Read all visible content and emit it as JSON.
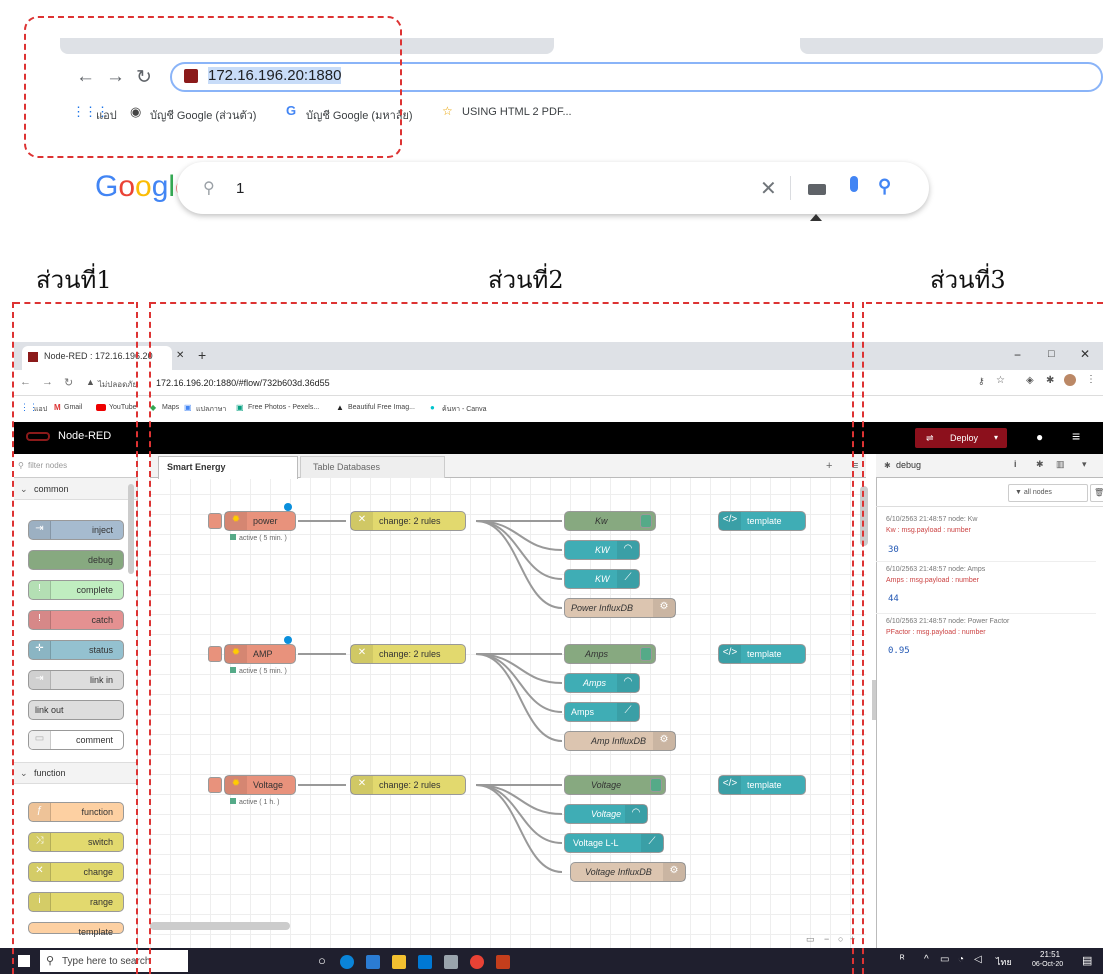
{
  "top_browser": {
    "url": "172.16.196.20:1880",
    "bookmarks": [
      "แอป",
      "บัญชี Google (ส่วนตัว)",
      "บัญชี Google (มหาลัย)",
      "USING HTML 2 PDF..."
    ],
    "google_logo": "Google",
    "search_value": "1"
  },
  "section_labels": [
    "ส่วนที่1",
    "ส่วนที่2",
    "ส่วนที่3"
  ],
  "nodered_browser": {
    "tab_title": "Node-RED : 172.16.196.20",
    "address_prefix": "ไม่ปลอดภัย",
    "address": "172.16.196.20:1880/#flow/732b603d.36d55",
    "bookmarks": [
      "แอป",
      "Gmail",
      "YouTube",
      "Maps",
      "แปลภาษา",
      "Free Photos - Pexels...",
      "Beautiful Free Imag...",
      "ค้นหา - Canva"
    ]
  },
  "nodered": {
    "title": "Node-RED",
    "deploy_label": "Deploy",
    "filter_placeholder": "filter nodes",
    "palette": {
      "category_common": "common",
      "common_nodes": [
        "inject",
        "debug",
        "complete",
        "catch",
        "status",
        "link in",
        "link out",
        "comment"
      ],
      "category_function": "function",
      "function_nodes": [
        "function",
        "switch",
        "change",
        "range",
        "template"
      ]
    },
    "tabs": [
      "Smart Energy",
      "Table Databases"
    ],
    "flows": [
      {
        "input": "power",
        "status": "active ( 5 min. )",
        "change": "change: 2 rules",
        "outputs": [
          "Kw",
          "KW",
          "KW",
          "Power InfluxDB"
        ],
        "template": "template"
      },
      {
        "input": "AMP",
        "status": "active ( 5 min. )",
        "change": "change: 2 rules",
        "outputs": [
          "Amps",
          "Amps",
          "Amps",
          "Amp InfluxDB"
        ],
        "template": "template"
      },
      {
        "input": "Voltage",
        "status": "active ( 1 h. )",
        "change": "change: 2 rules",
        "outputs": [
          "Voltage",
          "Voltage",
          "Voltage L-L",
          "Voltage InfluxDB"
        ],
        "template": "template"
      }
    ],
    "sidebar": {
      "tab_label": "debug",
      "filter_label": "all nodes",
      "messages": [
        {
          "meta": "6/10/2563 21:48:57  node: Kw",
          "topic": "Kw : msg.payload : number",
          "value": "30"
        },
        {
          "meta": "6/10/2563 21:48:57  node: Amps",
          "topic": "Amps : msg.payload : number",
          "value": "44"
        },
        {
          "meta": "6/10/2563 21:48:57  node: Power Factor",
          "topic": "PFactor : msg.payload : number",
          "value": "0.95"
        }
      ]
    }
  },
  "taskbar": {
    "search_placeholder": "Type here to search",
    "time": "21:51",
    "date": "06-Oct-20",
    "lang": "ไทย"
  }
}
